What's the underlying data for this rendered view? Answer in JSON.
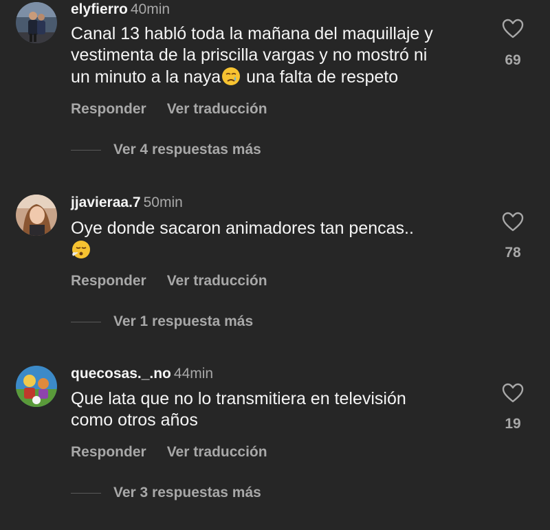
{
  "comments": [
    {
      "username": "elyfierro",
      "time": "40min",
      "text_lines": [
        "Canal 13 habló toda la mañana del maquillaje y",
        "vestimenta de la priscilla vargas y no mostró ni",
        "un minuto a la naya",
        " una falta de respeto"
      ],
      "emoji": "crying-face",
      "reply_label": "Responder",
      "translate_label": "Ver traducción",
      "replies_label": "Ver 4 respuestas más",
      "likes": "69"
    },
    {
      "username": "jjavieraa.7",
      "time": "50min",
      "text_lines": [
        "Oye donde sacaron animadores tan pencas.."
      ],
      "emoji": "face-exhaling",
      "reply_label": "Responder",
      "translate_label": "Ver traducción",
      "replies_label": "Ver 1 respuesta más",
      "likes": "78"
    },
    {
      "username": "quecosas._.no",
      "time": "44min",
      "text_lines": [
        "Que lata que no lo transmitiera en televisión",
        "como otros años"
      ],
      "reply_label": "Responder",
      "translate_label": "Ver traducción",
      "replies_label": "Ver 3 respuestas más",
      "likes": "19"
    }
  ],
  "colors": {
    "background": "#262626",
    "primary_text": "#f5f5f5",
    "secondary_text": "#a8a8a8"
  },
  "icons": [
    "heart-icon",
    "crying-face-emoji",
    "face-exhaling-emoji"
  ]
}
